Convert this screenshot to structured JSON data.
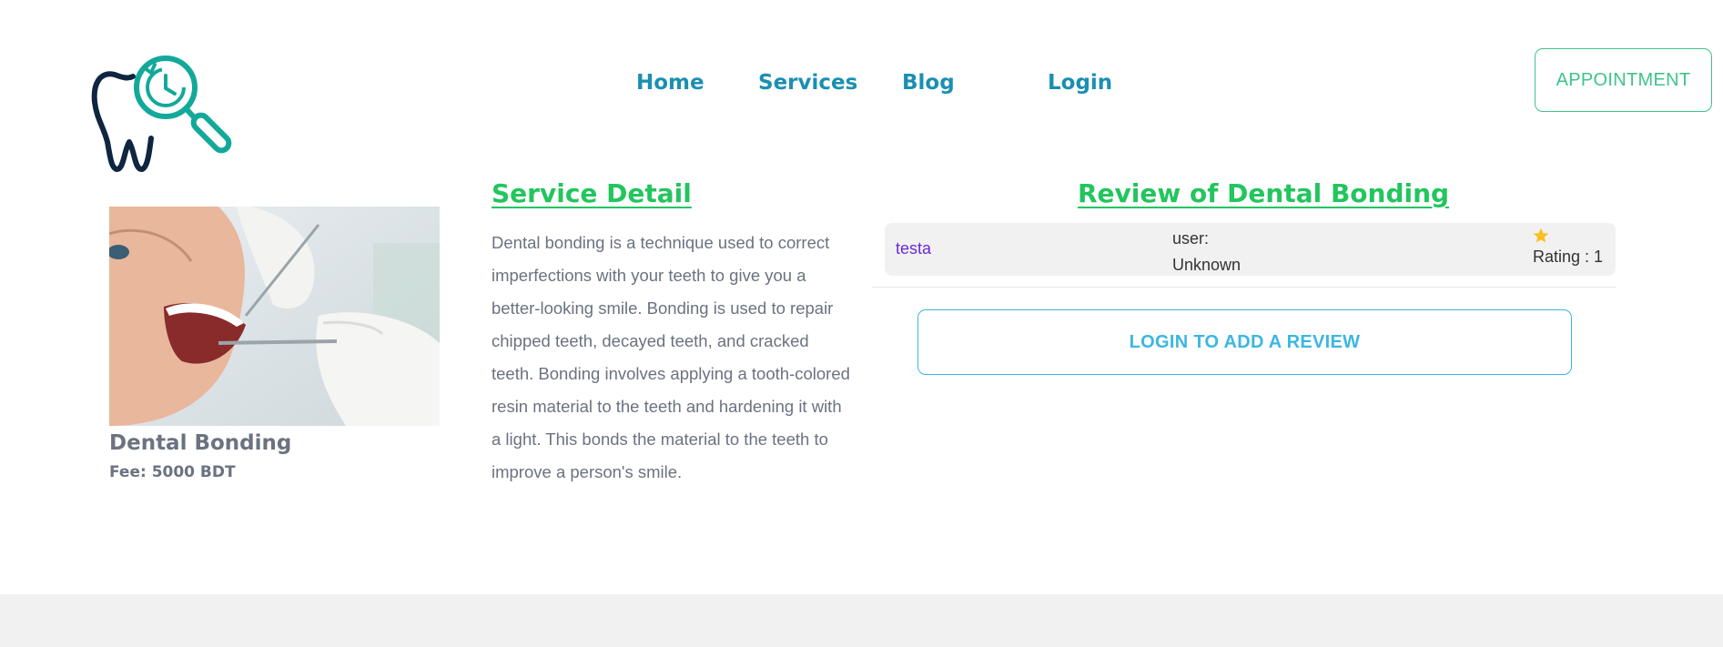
{
  "nav": {
    "home": "Home",
    "services": "Services",
    "blog": "Blog",
    "login": "Login",
    "appointment": "APPOINTMENT"
  },
  "service": {
    "name": "Dental Bonding",
    "fee": "Fee: 5000 BDT"
  },
  "detail": {
    "heading": "Service Detail",
    "description": "Dental bonding is a technique used to correct imperfections with your teeth to give you a better-looking smile. Bonding is used to repair chipped teeth, decayed teeth, and cracked teeth. Bonding involves applying a tooth-colored resin material to the teeth and hardening it with a light. This bonds the material to the teeth to improve a person's smile."
  },
  "reviews": {
    "heading": "Review of Dental Bonding",
    "items": [
      {
        "user": "testa",
        "label": "user:",
        "value": "Unknown",
        "rating": "Rating : 1",
        "icon": "star-icon"
      }
    ],
    "login_button": "LOGIN TO ADD A REVIEW"
  },
  "colors": {
    "accent_green": "#22c55e",
    "nav_blue": "#1b8fb0",
    "review_button": "#3cb6e3",
    "appointment": "#3ec48a",
    "star": "#fbbf24",
    "username": "#6d28d9"
  }
}
